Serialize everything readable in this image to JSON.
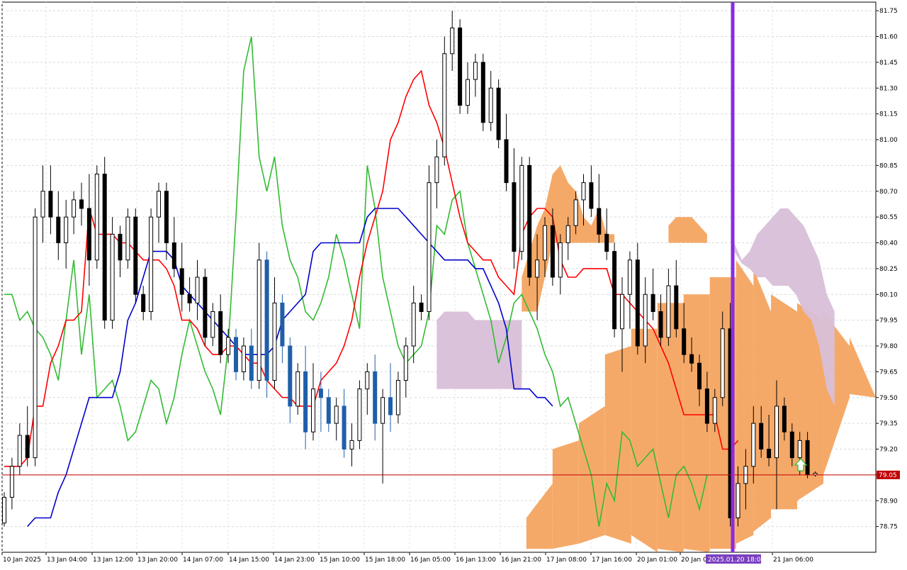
{
  "chart_data": {
    "type": "candlestick",
    "ylim": [
      78.6,
      81.8
    ],
    "y_ticks": [
      "81.75",
      "81.60",
      "81.45",
      "81.30",
      "81.15",
      "81.00",
      "80.85",
      "80.70",
      "80.55",
      "80.40",
      "80.25",
      "80.10",
      "79.95",
      "79.80",
      "79.65",
      "79.50",
      "79.35",
      "79.20",
      "79.05",
      "78.90",
      "78.75"
    ],
    "x_labels": [
      "10 Jan 2025",
      "13 Jan 04:00",
      "13 Jan 12:00",
      "13 Jan 20:00",
      "14 Jan 07:00",
      "14 Jan 15:00",
      "14 Jan 23:00",
      "15 Jan 10:00",
      "15 Jan 18:00",
      "16 Jan 05:00",
      "16 Jan 13:00",
      "16 Jan 21:00",
      "17 Jan 08:00",
      "17 Jan 16:00",
      "20 Jan 01:00",
      "20 Jan 0",
      "21 Jan 06:00"
    ],
    "current_price": {
      "value": 79.05,
      "label": "79.05",
      "color": "#c00000"
    },
    "cursor": {
      "label": "2025.01.20 18:00",
      "color": "#8a2be2"
    },
    "grid": true,
    "colors": {
      "tenkan": "#ff0000",
      "kijun": "#0000cc",
      "chikou": "#33bb33",
      "cloud_bull": "#f4a460",
      "cloud_bear": "#d8bfd8",
      "bull_candle": "#ffffff",
      "bear_candle": "#000000",
      "highlight_candle": "#1f5fa8"
    },
    "candles": [
      {
        "o": 78.77,
        "h": 78.95,
        "l": 78.75,
        "c": 78.92
      },
      {
        "o": 78.92,
        "h": 79.15,
        "l": 78.85,
        "c": 79.1
      },
      {
        "o": 79.1,
        "h": 79.35,
        "l": 79.05,
        "c": 79.28
      },
      {
        "o": 79.28,
        "h": 79.45,
        "l": 79.1,
        "c": 79.15
      },
      {
        "o": 79.15,
        "h": 80.6,
        "l": 79.1,
        "c": 80.55
      },
      {
        "o": 80.55,
        "h": 80.85,
        "l": 80.4,
        "c": 80.7
      },
      {
        "o": 80.7,
        "h": 80.85,
        "l": 80.45,
        "c": 80.55
      },
      {
        "o": 80.55,
        "h": 80.7,
        "l": 80.3,
        "c": 80.4
      },
      {
        "o": 80.4,
        "h": 80.65,
        "l": 80.25,
        "c": 80.55
      },
      {
        "o": 80.55,
        "h": 80.7,
        "l": 80.45,
        "c": 80.65
      },
      {
        "o": 80.65,
        "h": 80.75,
        "l": 80.5,
        "c": 80.6
      },
      {
        "o": 80.6,
        "h": 80.8,
        "l": 80.15,
        "c": 80.3
      },
      {
        "o": 80.3,
        "h": 80.85,
        "l": 80.25,
        "c": 80.8
      },
      {
        "o": 80.8,
        "h": 80.9,
        "l": 79.9,
        "c": 79.95
      },
      {
        "o": 79.95,
        "h": 80.55,
        "l": 79.9,
        "c": 80.45
      },
      {
        "o": 80.45,
        "h": 80.5,
        "l": 80.2,
        "c": 80.3
      },
      {
        "o": 80.3,
        "h": 80.6,
        "l": 80.25,
        "c": 80.55
      },
      {
        "o": 80.55,
        "h": 80.6,
        "l": 80.05,
        "c": 80.1
      },
      {
        "o": 80.1,
        "h": 80.15,
        "l": 79.95,
        "c": 80.0
      },
      {
        "o": 80.0,
        "h": 80.6,
        "l": 79.95,
        "c": 80.55
      },
      {
        "o": 80.55,
        "h": 80.75,
        "l": 80.4,
        "c": 80.7
      },
      {
        "o": 80.7,
        "h": 80.75,
        "l": 80.3,
        "c": 80.4
      },
      {
        "o": 80.4,
        "h": 80.55,
        "l": 80.2,
        "c": 80.25
      },
      {
        "o": 80.25,
        "h": 80.4,
        "l": 80.0,
        "c": 80.1
      },
      {
        "o": 80.1,
        "h": 80.2,
        "l": 80.0,
        "c": 80.05
      },
      {
        "o": 80.05,
        "h": 80.3,
        "l": 79.95,
        "c": 80.2
      },
      {
        "o": 80.2,
        "h": 80.25,
        "l": 79.8,
        "c": 79.85
      },
      {
        "o": 79.85,
        "h": 80.05,
        "l": 79.8,
        "c": 80.0
      },
      {
        "o": 80.0,
        "h": 80.1,
        "l": 79.7,
        "c": 79.75
      },
      {
        "o": 79.75,
        "h": 79.9,
        "l": 79.7,
        "c": 79.85
      },
      {
        "o": 79.85,
        "h": 79.9,
        "l": 79.6,
        "c": 79.65
      },
      {
        "o": 79.65,
        "h": 79.85,
        "l": 79.6,
        "c": 79.8
      },
      {
        "o": 79.8,
        "h": 79.9,
        "l": 79.55,
        "c": 79.6
      },
      {
        "o": 79.6,
        "h": 80.4,
        "l": 79.55,
        "c": 80.3
      },
      {
        "o": 80.3,
        "h": 80.35,
        "l": 79.5,
        "c": 79.6
      },
      {
        "o": 79.6,
        "h": 80.2,
        "l": 79.55,
        "c": 80.05
      },
      {
        "o": 80.05,
        "h": 80.1,
        "l": 79.7,
        "c": 79.8
      },
      {
        "o": 79.8,
        "h": 79.85,
        "l": 79.35,
        "c": 79.45
      },
      {
        "o": 79.45,
        "h": 79.7,
        "l": 79.4,
        "c": 79.65
      },
      {
        "o": 79.65,
        "h": 79.8,
        "l": 79.2,
        "c": 79.3
      },
      {
        "o": 79.3,
        "h": 79.7,
        "l": 79.25,
        "c": 79.55
      },
      {
        "o": 79.55,
        "h": 79.65,
        "l": 79.3,
        "c": 79.5
      },
      {
        "o": 79.5,
        "h": 79.55,
        "l": 79.3,
        "c": 79.35
      },
      {
        "o": 79.35,
        "h": 79.5,
        "l": 79.25,
        "c": 79.45
      },
      {
        "o": 79.45,
        "h": 79.55,
        "l": 79.15,
        "c": 79.2
      },
      {
        "o": 79.2,
        "h": 79.35,
        "l": 79.1,
        "c": 79.25
      },
      {
        "o": 79.25,
        "h": 79.6,
        "l": 79.2,
        "c": 79.55
      },
      {
        "o": 79.55,
        "h": 79.7,
        "l": 79.4,
        "c": 79.65
      },
      {
        "o": 79.65,
        "h": 79.75,
        "l": 79.25,
        "c": 79.35
      },
      {
        "o": 79.35,
        "h": 79.55,
        "l": 79.0,
        "c": 79.5
      },
      {
        "o": 79.5,
        "h": 79.7,
        "l": 79.3,
        "c": 79.4
      },
      {
        "o": 79.4,
        "h": 79.65,
        "l": 79.35,
        "c": 79.6
      },
      {
        "o": 79.6,
        "h": 79.85,
        "l": 79.5,
        "c": 79.8
      },
      {
        "o": 79.8,
        "h": 80.15,
        "l": 79.7,
        "c": 80.05
      },
      {
        "o": 80.05,
        "h": 80.1,
        "l": 79.95,
        "c": 80.0
      },
      {
        "o": 80.0,
        "h": 80.85,
        "l": 79.95,
        "c": 80.75
      },
      {
        "o": 80.75,
        "h": 81.0,
        "l": 80.6,
        "c": 80.9
      },
      {
        "o": 80.9,
        "h": 81.6,
        "l": 80.85,
        "c": 81.5
      },
      {
        "o": 81.5,
        "h": 81.75,
        "l": 81.4,
        "c": 81.65
      },
      {
        "o": 81.65,
        "h": 81.7,
        "l": 81.15,
        "c": 81.2
      },
      {
        "o": 81.2,
        "h": 81.45,
        "l": 81.15,
        "c": 81.35
      },
      {
        "o": 81.35,
        "h": 81.5,
        "l": 81.25,
        "c": 81.45
      },
      {
        "o": 81.45,
        "h": 81.5,
        "l": 81.05,
        "c": 81.1
      },
      {
        "o": 81.1,
        "h": 81.4,
        "l": 81.05,
        "c": 81.3
      },
      {
        "o": 81.3,
        "h": 81.35,
        "l": 80.95,
        "c": 81.0
      },
      {
        "o": 81.0,
        "h": 81.15,
        "l": 80.7,
        "c": 80.75
      },
      {
        "o": 80.75,
        "h": 80.95,
        "l": 80.25,
        "c": 80.35
      },
      {
        "o": 80.35,
        "h": 80.9,
        "l": 80.3,
        "c": 80.85
      },
      {
        "o": 80.85,
        "h": 80.9,
        "l": 80.15,
        "c": 80.2
      },
      {
        "o": 80.2,
        "h": 80.45,
        "l": 79.95,
        "c": 80.3
      },
      {
        "o": 80.3,
        "h": 80.55,
        "l": 80.2,
        "c": 80.5
      },
      {
        "o": 80.5,
        "h": 80.6,
        "l": 80.15,
        "c": 80.2
      },
      {
        "o": 80.2,
        "h": 80.45,
        "l": 80.1,
        "c": 80.4
      },
      {
        "o": 80.4,
        "h": 80.55,
        "l": 80.3,
        "c": 80.5
      },
      {
        "o": 80.5,
        "h": 80.7,
        "l": 80.45,
        "c": 80.65
      },
      {
        "o": 80.65,
        "h": 80.8,
        "l": 80.5,
        "c": 80.75
      },
      {
        "o": 80.75,
        "h": 80.85,
        "l": 80.55,
        "c": 80.6
      },
      {
        "o": 80.6,
        "h": 80.8,
        "l": 80.4,
        "c": 80.45
      },
      {
        "o": 80.45,
        "h": 80.6,
        "l": 80.3,
        "c": 80.35
      },
      {
        "o": 80.35,
        "h": 80.4,
        "l": 79.85,
        "c": 79.9
      },
      {
        "o": 79.9,
        "h": 80.2,
        "l": 79.65,
        "c": 80.1
      },
      {
        "o": 80.1,
        "h": 80.35,
        "l": 79.9,
        "c": 80.3
      },
      {
        "o": 80.3,
        "h": 80.4,
        "l": 79.75,
        "c": 79.8
      },
      {
        "o": 79.8,
        "h": 80.2,
        "l": 79.7,
        "c": 80.1
      },
      {
        "o": 80.1,
        "h": 80.25,
        "l": 79.95,
        "c": 80.0
      },
      {
        "o": 80.0,
        "h": 80.1,
        "l": 79.8,
        "c": 79.85
      },
      {
        "o": 79.85,
        "h": 80.25,
        "l": 79.8,
        "c": 80.15
      },
      {
        "o": 80.15,
        "h": 80.3,
        "l": 79.85,
        "c": 79.9
      },
      {
        "o": 79.9,
        "h": 80.05,
        "l": 79.7,
        "c": 79.75
      },
      {
        "o": 79.75,
        "h": 79.85,
        "l": 79.65,
        "c": 79.7
      },
      {
        "o": 79.7,
        "h": 79.75,
        "l": 79.45,
        "c": 79.55
      },
      {
        "o": 79.55,
        "h": 79.65,
        "l": 79.3,
        "c": 79.35
      },
      {
        "o": 79.35,
        "h": 79.55,
        "l": 79.3,
        "c": 79.5
      },
      {
        "o": 79.5,
        "h": 80.0,
        "l": 79.45,
        "c": 79.9
      },
      {
        "o": 79.9,
        "h": 80.05,
        "l": 78.75,
        "c": 78.8
      },
      {
        "o": 78.8,
        "h": 79.1,
        "l": 78.75,
        "c": 79.0
      },
      {
        "o": 79.0,
        "h": 79.2,
        "l": 78.85,
        "c": 79.1
      },
      {
        "o": 79.1,
        "h": 79.45,
        "l": 79.0,
        "c": 79.35
      },
      {
        "o": 79.35,
        "h": 79.45,
        "l": 79.15,
        "c": 79.2
      },
      {
        "o": 79.2,
        "h": 79.4,
        "l": 79.1,
        "c": 79.15
      },
      {
        "o": 79.15,
        "h": 79.6,
        "l": 78.85,
        "c": 79.45
      },
      {
        "o": 79.45,
        "h": 79.5,
        "l": 79.25,
        "c": 79.3
      },
      {
        "o": 79.3,
        "h": 79.35,
        "l": 79.1,
        "c": 79.15
      },
      {
        "o": 79.15,
        "h": 79.3,
        "l": 79.05,
        "c": 79.25
      },
      {
        "o": 79.25,
        "h": 79.3,
        "l": 79.03,
        "c": 79.05
      },
      {
        "o": 79.05,
        "h": 79.07,
        "l": 79.04,
        "c": 79.06
      }
    ],
    "cloud": [
      {
        "x": 0,
        "a": [
          78.6,
          78.6
        ],
        "b": [
          78.6,
          78.6
        ]
      },
      {
        "x": 60,
        "a": [
          78.62,
          78.8
        ],
        "b": [
          78.62,
          78.62
        ]
      },
      {
        "x": 63,
        "a": [
          79.0,
          79.2
        ],
        "b": [
          78.62,
          78.62
        ]
      },
      {
        "x": 66,
        "a": [
          79.25,
          79.35
        ],
        "b": [
          78.65,
          78.65
        ]
      },
      {
        "x": 69,
        "a": [
          79.45,
          79.75
        ],
        "b": [
          78.7,
          78.7
        ]
      },
      {
        "x": 72,
        "a": [
          79.8,
          79.9
        ],
        "b": [
          78.65,
          78.7
        ]
      },
      {
        "x": 75,
        "a": [
          79.9,
          80.05
        ],
        "b": [
          78.6,
          78.62
        ]
      },
      {
        "x": 78,
        "a": [
          80.05,
          80.1
        ],
        "b": [
          78.6,
          78.62
        ]
      },
      {
        "x": 81,
        "a": [
          80.1,
          80.2
        ],
        "b": [
          78.6,
          78.62
        ]
      },
      {
        "x": 84,
        "a": [
          80.2,
          80.3
        ],
        "b": [
          78.62,
          78.65
        ]
      },
      {
        "x": 86,
        "a": [
          80.15,
          80.25
        ],
        "b": [
          78.7,
          78.72
        ]
      },
      {
        "x": 88,
        "a": [
          80.0,
          80.1
        ],
        "b": [
          78.8,
          78.85
        ]
      },
      {
        "x": 91,
        "a": [
          80.0,
          80.05
        ],
        "b": [
          78.85,
          78.9
        ]
      },
      {
        "x": 94,
        "a": [
          79.95,
          80.0
        ],
        "b": [
          79.0,
          79.05
        ]
      },
      {
        "x": 97,
        "a": [
          79.8,
          79.85
        ],
        "b": [
          79.5,
          79.52
        ]
      },
      {
        "x": 100,
        "a": [
          79.5,
          79.5
        ],
        "b": [
          79.5,
          79.5
        ]
      }
    ],
    "tenkan": [
      79.1,
      79.1,
      79.1,
      79.15,
      79.45,
      79.45,
      79.7,
      79.8,
      79.95,
      79.95,
      80.0,
      80.6,
      80.45,
      80.45,
      80.45,
      80.4,
      80.4,
      80.35,
      80.3,
      80.3,
      80.3,
      80.25,
      80.15,
      79.95,
      79.95,
      79.9,
      79.8,
      79.75,
      79.75,
      79.8,
      79.8,
      79.75,
      79.7,
      79.7,
      79.6,
      79.55,
      79.5,
      79.5,
      79.45,
      79.45,
      79.45,
      79.6,
      79.65,
      79.7,
      79.8,
      79.95,
      80.2,
      80.4,
      80.55,
      80.7,
      81.0,
      81.1,
      81.25,
      81.35,
      81.4,
      81.2,
      81.1,
      80.95,
      80.75,
      80.55,
      80.4,
      80.35,
      80.3,
      80.3,
      80.2,
      80.15,
      80.1,
      80.45,
      80.55,
      80.6,
      80.6,
      80.55,
      80.3,
      80.2,
      80.2,
      80.25,
      80.25,
      80.25,
      80.25,
      80.1,
      80.1,
      80.05,
      80.0,
      79.95,
      79.9,
      79.8,
      79.7,
      79.55,
      79.4,
      79.4,
      79.4,
      79.4,
      79.4,
      79.2,
      79.2,
      79.25
    ],
    "kijun": [
      78.75,
      78.8,
      78.8,
      78.8,
      78.95,
      79.05,
      79.2,
      79.35,
      79.5,
      79.5,
      79.5,
      79.5,
      79.65,
      79.95,
      80.05,
      80.2,
      80.35,
      80.35,
      80.35,
      80.3,
      80.15,
      80.1,
      80.05,
      80.0,
      79.95,
      79.9,
      79.85,
      79.8,
      79.75,
      79.75,
      79.75,
      79.75,
      79.8,
      79.95,
      80.0,
      80.05,
      80.1,
      80.35,
      80.4,
      80.4,
      80.4,
      80.4,
      80.4,
      80.4,
      80.55,
      80.6,
      80.6,
      80.6,
      80.6,
      80.55,
      80.5,
      80.45,
      80.4,
      80.35,
      80.3,
      80.3,
      80.3,
      80.3,
      80.25,
      80.25,
      80.15,
      80.05,
      79.9,
      79.55,
      79.55,
      79.55,
      79.5,
      79.5,
      79.45
    ],
    "chikou": [
      80.1,
      80.1,
      79.95,
      80.0,
      79.9,
      79.85,
      79.75,
      79.6,
      79.95,
      80.3,
      79.75,
      80.1,
      79.5,
      79.55,
      79.6,
      79.45,
      79.25,
      79.3,
      79.45,
      79.6,
      79.55,
      79.35,
      79.5,
      79.75,
      79.95,
      79.8,
      79.65,
      79.55,
      79.4,
      79.8,
      80.55,
      81.4,
      81.6,
      80.9,
      80.7,
      80.9,
      80.5,
      80.3,
      80.2,
      80.0,
      79.95,
      80.05,
      80.2,
      80.45,
      80.3,
      80.1,
      79.9,
      80.85,
      80.6,
      80.2,
      80.0,
      79.8,
      79.7,
      79.75,
      79.8,
      80.0,
      80.5,
      80.45,
      80.65,
      80.7,
      80.4,
      80.25,
      80.1,
      79.95,
      79.7,
      79.85,
      80.05,
      80.1,
      80.0,
      79.9,
      79.75,
      79.65,
      79.45,
      79.5,
      79.35,
      79.2,
      79.05,
      78.75,
      79.0,
      78.9,
      79.3,
      79.25,
      79.1,
      79.15,
      79.2,
      79.0,
      78.8,
      79.05,
      79.1,
      79.0,
      78.85,
      79.05
    ]
  }
}
